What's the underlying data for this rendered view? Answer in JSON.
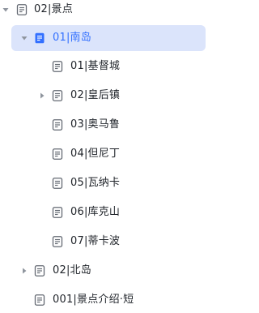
{
  "tree": {
    "items": [
      {
        "label": "02|景点",
        "level": 0,
        "caret": "down",
        "icon": "document-icon",
        "selected": false
      },
      {
        "label": "01|南岛",
        "level": 1,
        "caret": "down",
        "icon": "document-filled-icon",
        "selected": true
      },
      {
        "label": "01|基督城",
        "level": 2,
        "caret": "none",
        "icon": "document-icon",
        "selected": false
      },
      {
        "label": "02|皇后镇",
        "level": 2,
        "caret": "right",
        "icon": "document-icon",
        "selected": false
      },
      {
        "label": "03|奥马鲁",
        "level": 2,
        "caret": "none",
        "icon": "document-icon",
        "selected": false
      },
      {
        "label": "04|但尼丁",
        "level": 2,
        "caret": "none",
        "icon": "document-icon",
        "selected": false
      },
      {
        "label": "05|瓦纳卡",
        "level": 2,
        "caret": "none",
        "icon": "document-icon",
        "selected": false
      },
      {
        "label": "06|库克山",
        "level": 2,
        "caret": "none",
        "icon": "document-icon",
        "selected": false
      },
      {
        "label": "07|蒂卡波",
        "level": 2,
        "caret": "none",
        "icon": "document-icon",
        "selected": false
      },
      {
        "label": "02|北岛",
        "level": 1,
        "caret": "right",
        "icon": "document-icon",
        "selected": false
      },
      {
        "label": "001|景点介绍·短",
        "level": 1,
        "caret": "none",
        "icon": "document-icon",
        "selected": false
      }
    ]
  },
  "colors": {
    "selected_bg": "#dbe4fb",
    "selected_text": "#3370ff",
    "text": "#1f2329",
    "icon": "#646a73",
    "caret": "#8f959e"
  }
}
